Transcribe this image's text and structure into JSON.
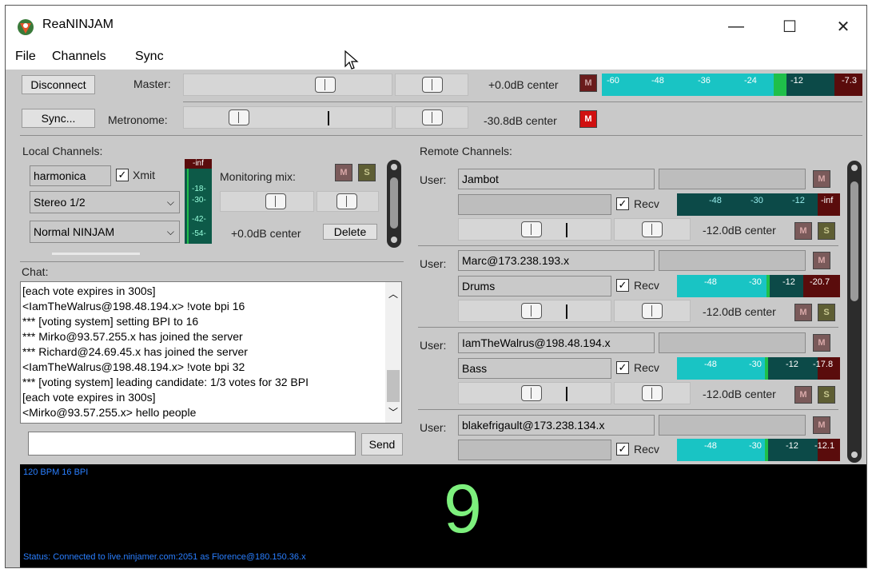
{
  "window": {
    "title": "ReaNINJAM",
    "minimize": "—",
    "maximize": "☐",
    "close": "✕"
  },
  "menu": [
    "File",
    "Channels",
    "Sync"
  ],
  "master": {
    "disconnect_label": "Disconnect",
    "sync_label": "Sync...",
    "master_label": "Master:",
    "metronome_label": "Metronome:",
    "master_readout": "+0.0dB center",
    "metronome_readout": "-30.8dB center",
    "mute_label": "M",
    "meter_ticks": [
      "-60",
      "-48",
      "-36",
      "-24",
      "-12",
      "-7.3"
    ]
  },
  "local": {
    "heading": "Local Channels:",
    "name_value": "harmonica",
    "xmit_label": "Xmit",
    "input_select": "Stereo 1/2",
    "mode_select": "Normal NINJAM",
    "vu_labels": [
      "-inf",
      "-18-",
      "-30-",
      "-42-",
      "-54-"
    ],
    "monitoring_label": "Monitoring mix:",
    "readout": "+0.0dB center",
    "delete_label": "Delete",
    "mute_label": "M",
    "solo_label": "S"
  },
  "chat": {
    "heading": "Chat:",
    "lines": [
      "[each vote expires in 300s]",
      "<IamTheWalrus@198.48.194.x> !vote bpi 16",
      "*** [voting system] setting BPI to 16",
      "*** Mirko@93.57.255.x has joined the server",
      "*** Richard@24.69.45.x has joined the server",
      "<IamTheWalrus@198.48.194.x> !vote bpi 32",
      "*** [voting system] leading candidate: 1/3 votes for 32 BPI",
      "[each vote expires in 300s]",
      "<Mirko@93.57.255.x> hello people"
    ],
    "input_value": "",
    "send_label": "Send"
  },
  "remote": {
    "heading": "Remote Channels:",
    "user_label": "User:",
    "recv_label": "Recv",
    "mute_label": "M",
    "solo_label": "S",
    "users": [
      {
        "name": "Jambot",
        "channel": "",
        "readout": "-12.0dB center",
        "ticks": [
          "-48",
          "-30",
          "-12",
          "-inf"
        ]
      },
      {
        "name": "Marc@173.238.193.x",
        "channel": "Drums",
        "readout": "-12.0dB center",
        "ticks": [
          "-48",
          "-30",
          "-12",
          "-20.7"
        ]
      },
      {
        "name": "IamTheWalrus@198.48.194.x",
        "channel": "Bass",
        "readout": "-12.0dB center",
        "ticks": [
          "-48",
          "-30",
          "-12",
          "-17.8"
        ]
      },
      {
        "name": "blakefrigault@173.238.134.x",
        "channel": "",
        "readout": "",
        "ticks": [
          "-48",
          "-30",
          "-12",
          "-12.1"
        ]
      }
    ]
  },
  "status": {
    "tempo": "120 BPM 16 BPI",
    "beat": "9",
    "status_line": "Status: Connected to live.ninjamer.com:2051 as Florence@180.150.36.x"
  },
  "colors": {
    "meter_cyan": "#19c4c4",
    "meter_dark": "#0c4a48",
    "meter_green": "#1fbf4a",
    "meter_red": "#5a0c0c",
    "beat_green": "#7df07d",
    "status_blue": "#2a7fff"
  }
}
